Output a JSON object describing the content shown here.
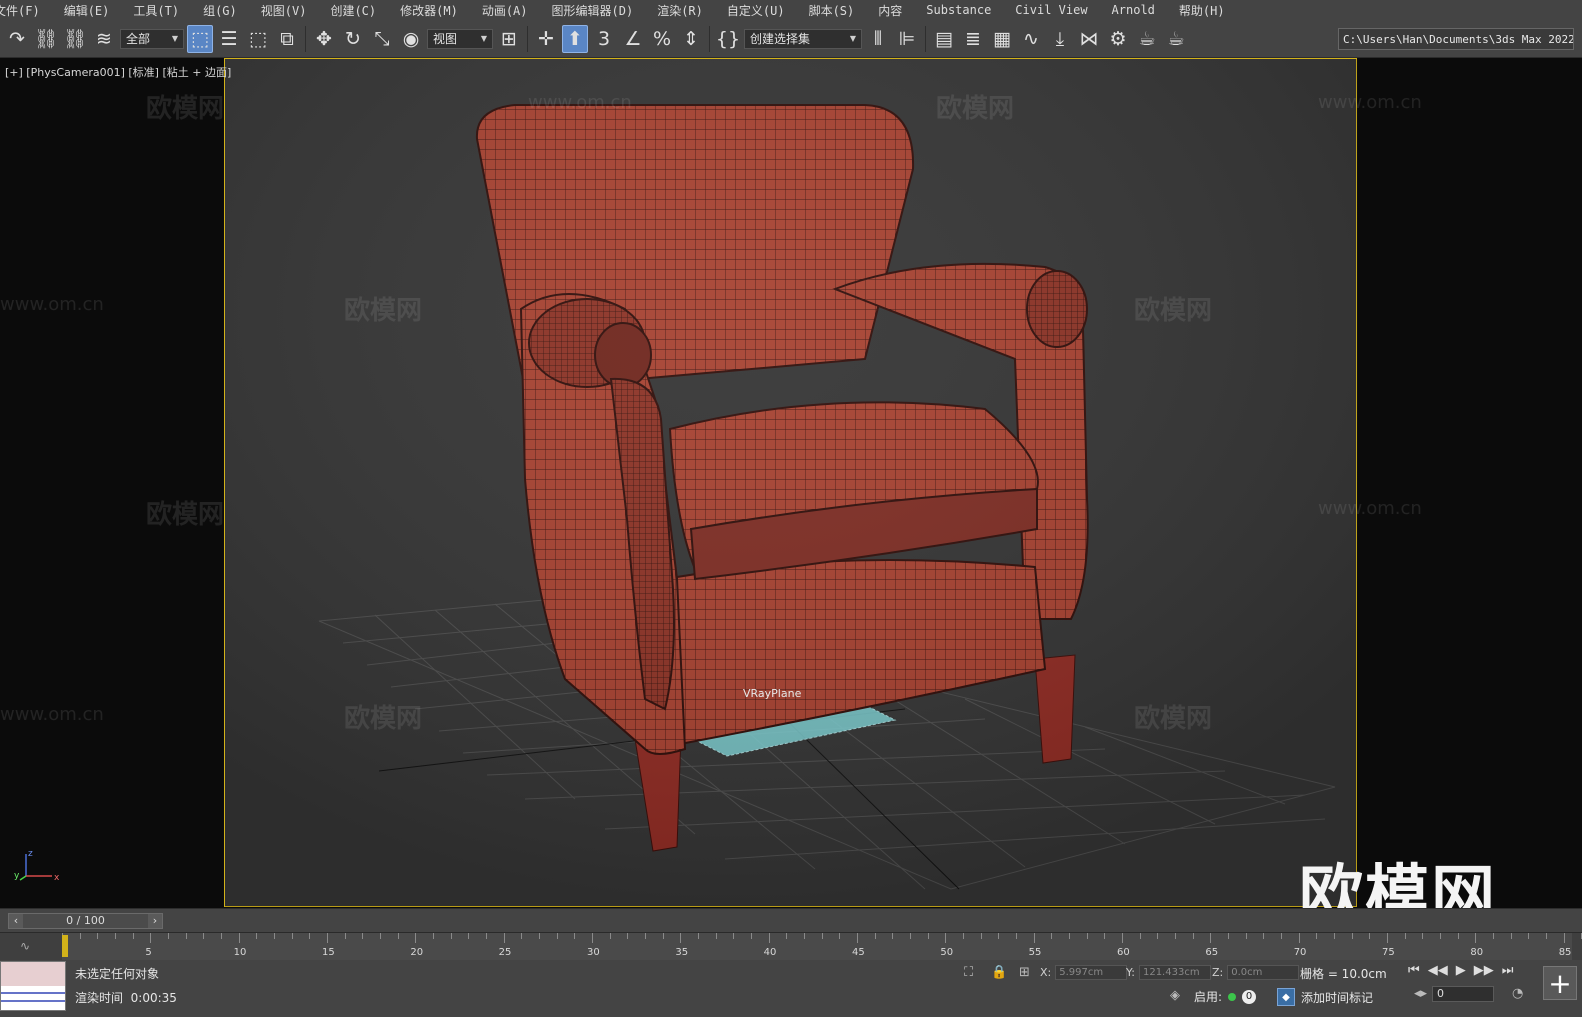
{
  "menu": [
    "文件(F)",
    "编辑(E)",
    "工具(T)",
    "组(G)",
    "视图(V)",
    "创建(C)",
    "修改器(M)",
    "动画(A)",
    "图形编辑器(D)",
    "渲染(R)",
    "自定义(U)",
    "脚本(S)",
    "内容",
    "Substance",
    "Civil View",
    "Arnold",
    "帮助(H)"
  ],
  "toolbar": {
    "filter_value": "全部",
    "refcoord_value": "视图",
    "selection_set_placeholder": "创建选择集",
    "snap_label": "3",
    "project_path": "C:\\Users\\Han\\Documents\\3ds Max 2022"
  },
  "viewport": {
    "label": "[+] [PhysCamera001] [标准] [粘土 + 边面]",
    "object_label": "VRayPlane",
    "axis_labels": {
      "z": "z",
      "x": "x",
      "y": "y"
    },
    "colors": {
      "mesh": "#a23a2c",
      "wire": "#3d120d",
      "plane": "#7fd3d6",
      "border": "#d2b21a"
    }
  },
  "watermark": {
    "text": "欧模网",
    "url": "www.om.cn",
    "big_logo": "欧模网"
  },
  "timeline": {
    "slider_text": "0 / 100",
    "ticks": [
      "5",
      "10",
      "15",
      "20",
      "25",
      "30",
      "35",
      "40",
      "45",
      "50",
      "55",
      "60",
      "65",
      "70",
      "75",
      "80",
      "85"
    ],
    "current": 0,
    "total": 100
  },
  "status": {
    "selection": "未选定任何对象",
    "render_time_label": "渲染时间",
    "render_time": "0:00:35",
    "x_label": "X:",
    "x_value": "5.997cm",
    "y_label": "Y:",
    "y_value": "121.433cm",
    "z_label": "Z:",
    "z_value": "0.0cm",
    "grid": "栅格 = 10.0cm",
    "enable_label": "启用:",
    "enable_count": "0",
    "add_time_tag": "添加时间标记",
    "frame_value": "0"
  }
}
